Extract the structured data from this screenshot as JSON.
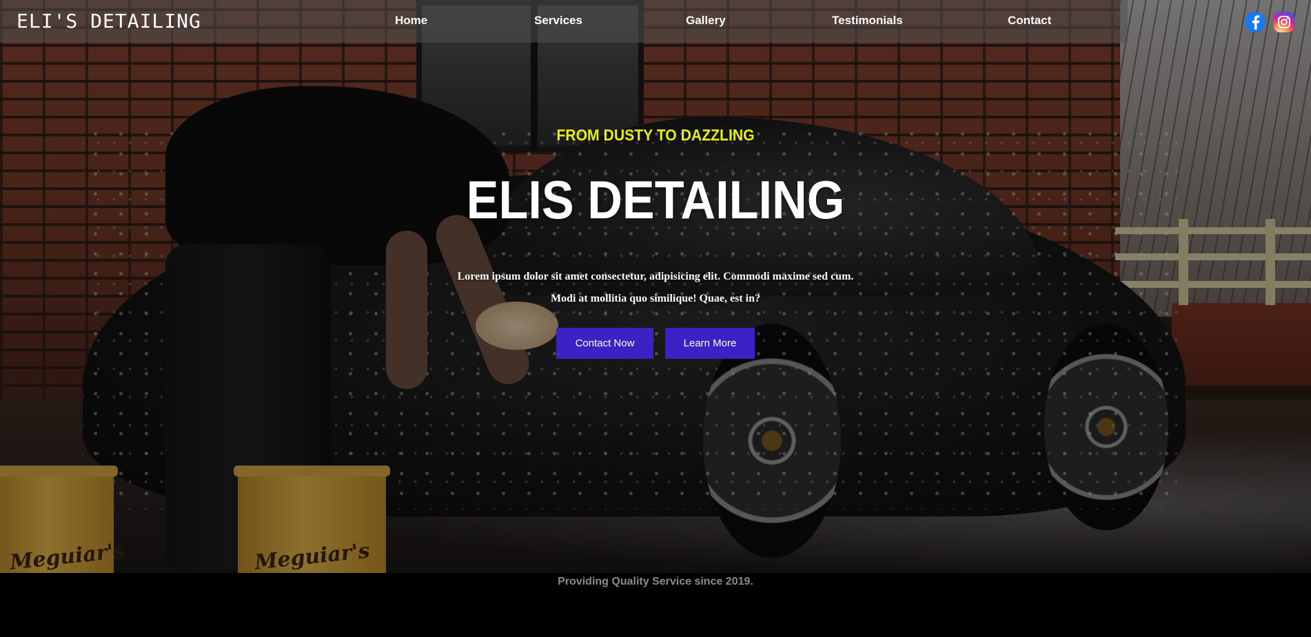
{
  "brand": {
    "name": "ELI'S DETAILING"
  },
  "nav": {
    "items": [
      {
        "label": "Home"
      },
      {
        "label": "Services"
      },
      {
        "label": "Gallery"
      },
      {
        "label": "Testimonials"
      },
      {
        "label": "Contact"
      }
    ]
  },
  "social": {
    "facebook_icon": "facebook-icon",
    "instagram_icon": "instagram-icon"
  },
  "hero": {
    "tagline": "FROM DUSTY TO DAZZLING",
    "headline": "ELIS DETAILING",
    "description": "Lorem ipsum dolor sit amet consectetur, adipisicing elit. Commodi maxime sed cum. Modi at mollitia quo similique! Quae, est in?",
    "buttons": {
      "contact": "Contact Now",
      "learn": "Learn More"
    },
    "bucket_text": "Meguiar's"
  },
  "footer": {
    "since": "Providing Quality Service since 2019."
  },
  "colors": {
    "accent_button": "#3b22c6",
    "tagline": "#e6ee1a",
    "since_text": "#8a8a8a"
  }
}
